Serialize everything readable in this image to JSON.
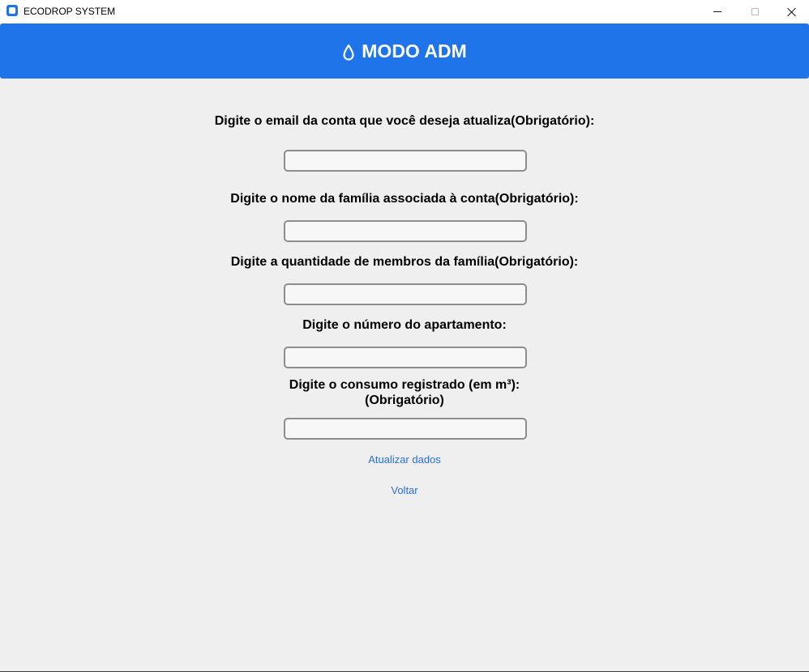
{
  "window": {
    "title": "ECODROP SYSTEM",
    "controls": {
      "minimize_icon": "minimize-icon",
      "maximize_icon": "maximize-icon",
      "close_icon": "close-icon"
    }
  },
  "header": {
    "icon": "water-drop-icon",
    "title": "MODO ADM",
    "background": "#1e74e8"
  },
  "form": {
    "email_label": "Digite o email da conta que você deseja atualiza(Obrigatório):",
    "email_value": "",
    "family_name_label": "Digite o nome da família associada à conta(Obrigatório):",
    "family_name_value": "",
    "members_label": "Digite a quantidade de membros da família(Obrigatório):",
    "members_value": "",
    "apartment_label": "Digite o número do apartamento:",
    "apartment_value": "",
    "consumption_label_line1": "Digite o consumo registrado (em m³):",
    "consumption_label_line2": "(Obrigatório)",
    "consumption_value": ""
  },
  "actions": {
    "update_label": "Atualizar dados",
    "back_label": "Voltar",
    "link_color": "#2a6fd6"
  }
}
